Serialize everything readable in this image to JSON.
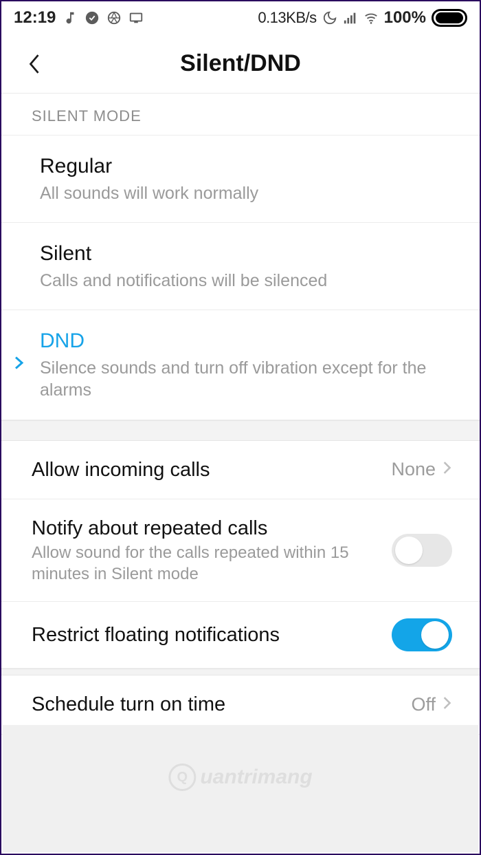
{
  "status": {
    "time": "12:19",
    "net": "0.13KB/s",
    "battery": "100%"
  },
  "header": {
    "title": "Silent/DND"
  },
  "section": {
    "label": "SILENT MODE"
  },
  "modes": [
    {
      "title": "Regular",
      "sub": "All sounds will work normally",
      "selected": false
    },
    {
      "title": "Silent",
      "sub": "Calls and notifications will be silenced",
      "selected": false
    },
    {
      "title": "DND",
      "sub": "Silence sounds and turn off vibration except for the alarms",
      "selected": true
    }
  ],
  "options": {
    "allow_calls": {
      "title": "Allow incoming calls",
      "value": "None"
    },
    "repeated": {
      "title": "Notify about repeated calls",
      "sub": "Allow sound for the calls repeated within 15 minutes in Silent mode",
      "on": false
    },
    "restrict": {
      "title": "Restrict floating notifications",
      "on": true
    },
    "schedule": {
      "title": "Schedule turn on time",
      "value": "Off"
    }
  },
  "watermark": "uantrimang"
}
